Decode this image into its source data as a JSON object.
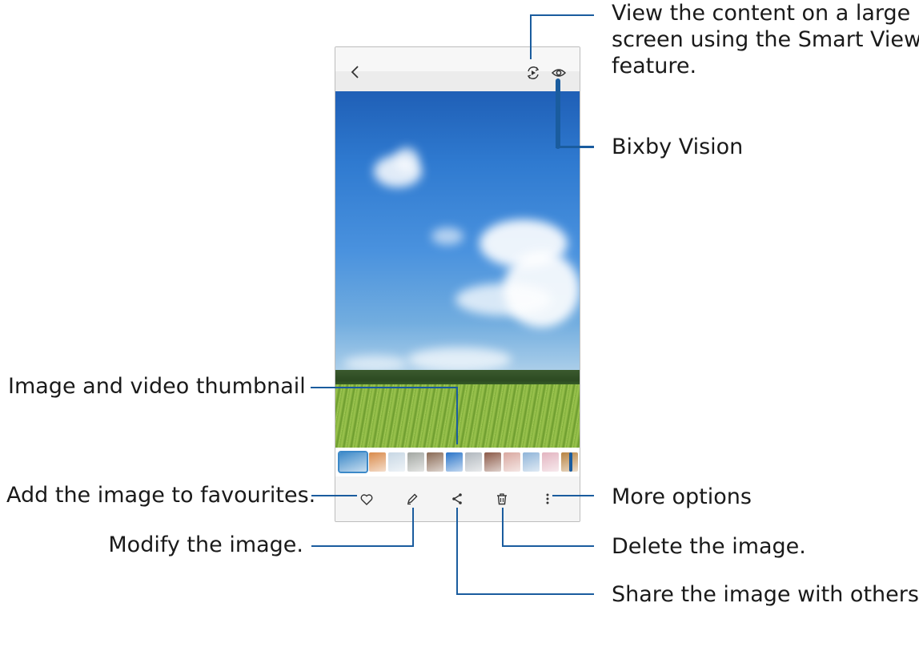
{
  "screen": {
    "icons": {
      "back": "chevron-left-icon",
      "smart_view": "smart-view-icon",
      "bixby_vision": "eye-icon",
      "favourite": "heart-icon",
      "edit": "pencil-icon",
      "share": "share-icon",
      "delete": "trash-icon",
      "more": "more-vertical-icon"
    },
    "thumbnail_colors": [
      "#3c89c8",
      "#d98a4a",
      "#c7d7e4",
      "#a3a7a2",
      "#8a6a55",
      "#2a75c9",
      "#b0b7bd",
      "#8c5a48",
      "#d9a8a0",
      "#8fb4d8",
      "#e3b4c0",
      "#b88442"
    ]
  },
  "annotations": {
    "smart_view": [
      "View the content on a large",
      "screen using the Smart View",
      "feature."
    ],
    "bixby_vision": "Bixby Vision",
    "thumbnail": "Image and video thumbnail",
    "favourites": "Add the image to favourites.",
    "more_options": "More options",
    "modify": "Modify the image.",
    "delete": "Delete the image.",
    "share": "Share the image with others."
  },
  "colors": {
    "callout_line": "#1a5c9e"
  }
}
